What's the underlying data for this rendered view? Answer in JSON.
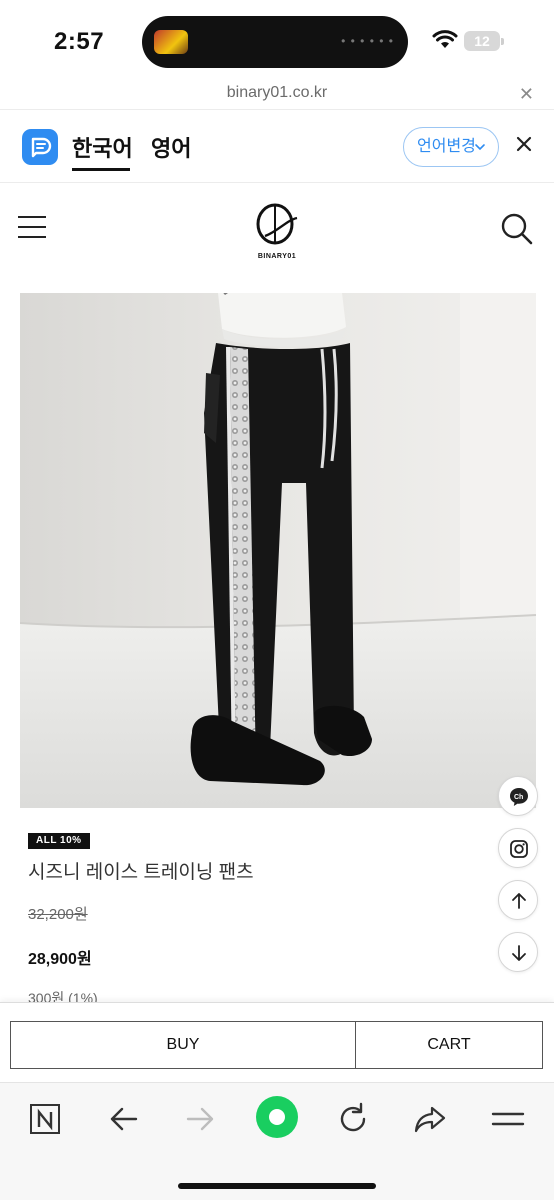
{
  "status_bar": {
    "time": "2:57",
    "battery_level": "12"
  },
  "url_bar": {
    "url": "binary01.co.kr"
  },
  "translate_bar": {
    "tabs": [
      {
        "label": "한국어",
        "active": true
      },
      {
        "label": "영어",
        "active": false
      }
    ],
    "change_language_label": "언어변경",
    "accent_color": "#2f8cf1"
  },
  "site_header": {
    "brand_name": "BINARY01"
  },
  "product": {
    "badge": "ALL 10%",
    "name": "시즈니 레이스 트레이닝 팬츠",
    "original_price": "32,200원",
    "sale_price": "28,900원",
    "points": "300원 (1%)"
  },
  "floating_buttons": [
    "chat-icon",
    "instagram-icon",
    "arrow-up-icon",
    "arrow-down-icon"
  ],
  "purchase_bar": {
    "buy_label": "BUY",
    "cart_label": "CART"
  },
  "browser_toolbar": {
    "items": [
      "naver-icon",
      "back-icon",
      "forward-icon",
      "green-home-icon",
      "reload-icon",
      "share-icon",
      "menu-icon"
    ],
    "green_color": "#19ce60"
  }
}
